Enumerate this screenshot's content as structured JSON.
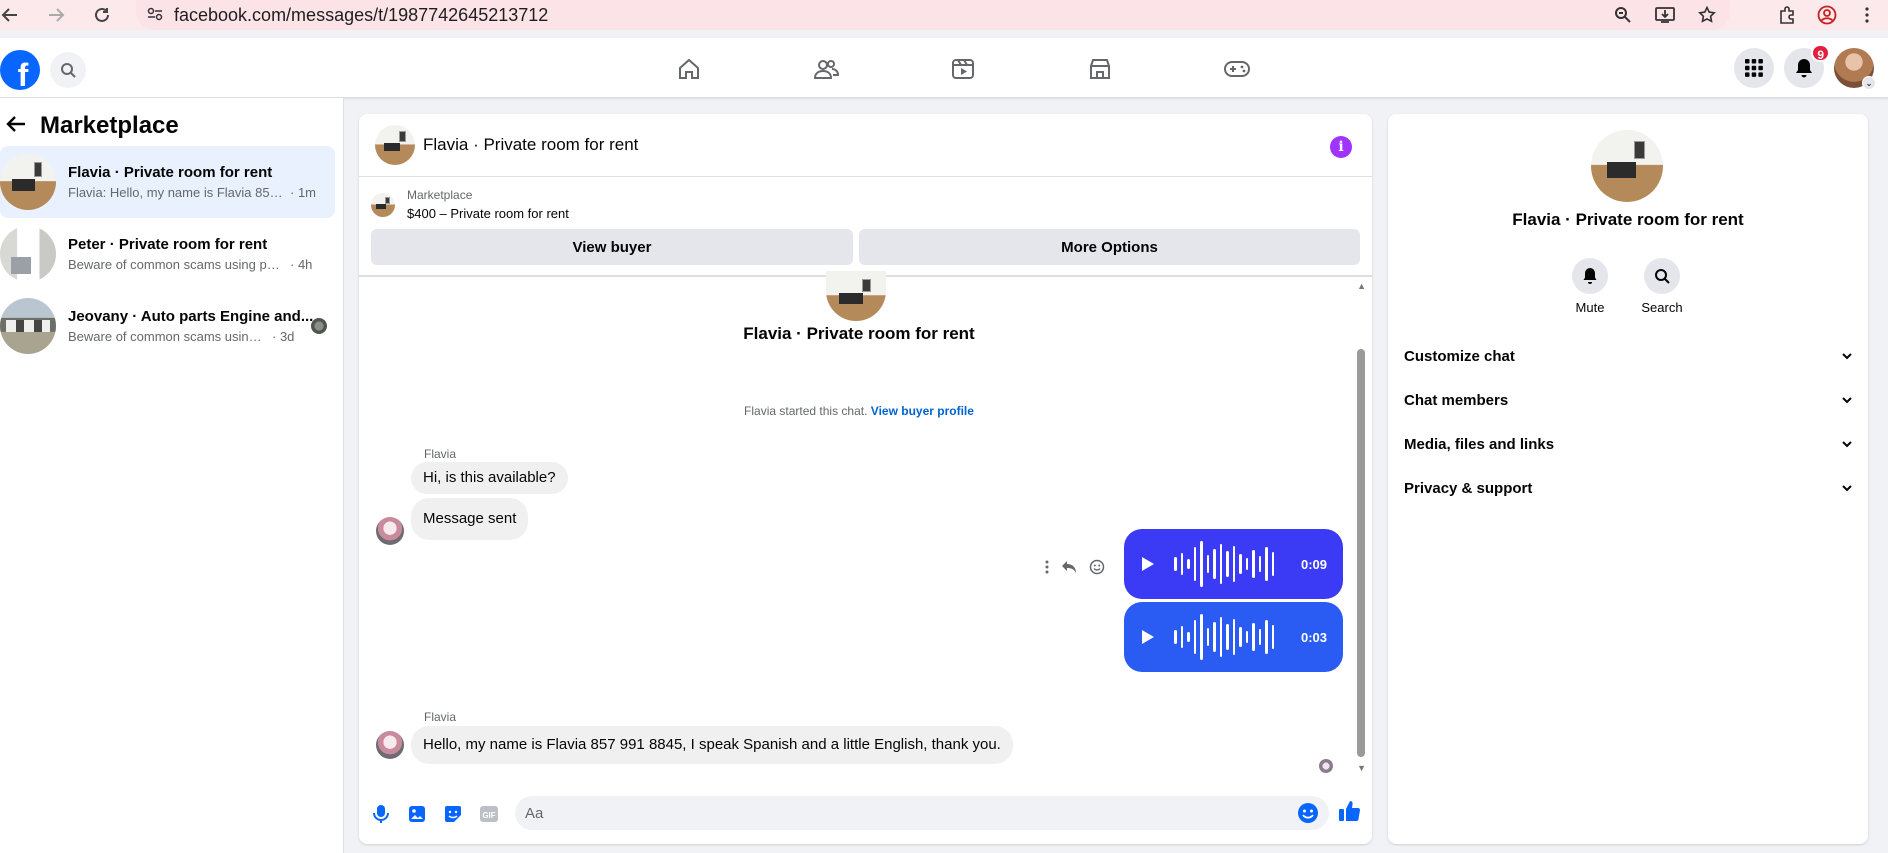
{
  "browser": {
    "url": "facebook.com/messages/t/1987742645213712"
  },
  "nav": {
    "notifications_count": "9"
  },
  "sidebar": {
    "title": "Marketplace",
    "conversations": [
      {
        "name": "Flavia · Private room for rent",
        "snippet": "Flavia: Hello, my name is Flavia 857 9...",
        "time": "· 1m"
      },
      {
        "name": "Peter · Private room for rent",
        "snippet": "Beware of common scams using pay...",
        "time": "· 4h"
      },
      {
        "name": "Jeovany · Auto parts Engine and...",
        "snippet": "Beware of common scams using p...",
        "time": "· 3d"
      }
    ]
  },
  "chat": {
    "title": "Flavia · Private room for rent",
    "marketplace_label": "Marketplace",
    "listing_price": "$400 – Private room for rent",
    "view_buyer_label": "View buyer",
    "more_options_label": "More Options",
    "thread_title": "Flavia · Private room for rent",
    "started_text": "Flavia started this chat.",
    "view_buyer_profile_label": "View buyer profile",
    "messages": [
      {
        "sender": "Flavia",
        "text": "Hi, is this available?"
      },
      {
        "text": "Message sent"
      },
      {
        "voice_duration": "0:09"
      },
      {
        "voice_duration": "0:03"
      },
      {
        "sender": "Flavia",
        "text": "Hello, my name is Flavia 857 991 8845, I speak Spanish and a little English, thank you."
      }
    ],
    "composer_placeholder": "Aa"
  },
  "details": {
    "title": "Flavia · Private room for rent",
    "mute_label": "Mute",
    "search_label": "Search",
    "sections": [
      "Customize chat",
      "Chat members",
      "Media, files and links",
      "Privacy & support"
    ]
  },
  "colors": {
    "brand": "#0866ff",
    "voice_bubble": "#3b3bf5",
    "info_icon": "#a033ff",
    "active_conversation": "#e8f1fd"
  }
}
